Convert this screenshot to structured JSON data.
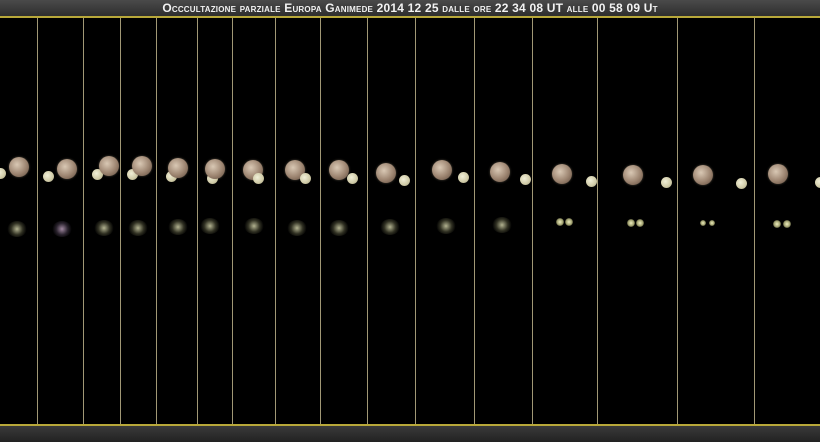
{
  "header": {
    "title": "Occcultazione parziale Europa Ganimede 2014 12 25 dalle ore 22 34 08 UT alle 00 58 09 Ut"
  },
  "colors": {
    "background": "#000000",
    "divider": "#bdb38a",
    "accent_rule": "#b8a83a"
  },
  "icons": [
    "ganymede-disk",
    "europa-disk",
    "merged-blur-image"
  ]
}
